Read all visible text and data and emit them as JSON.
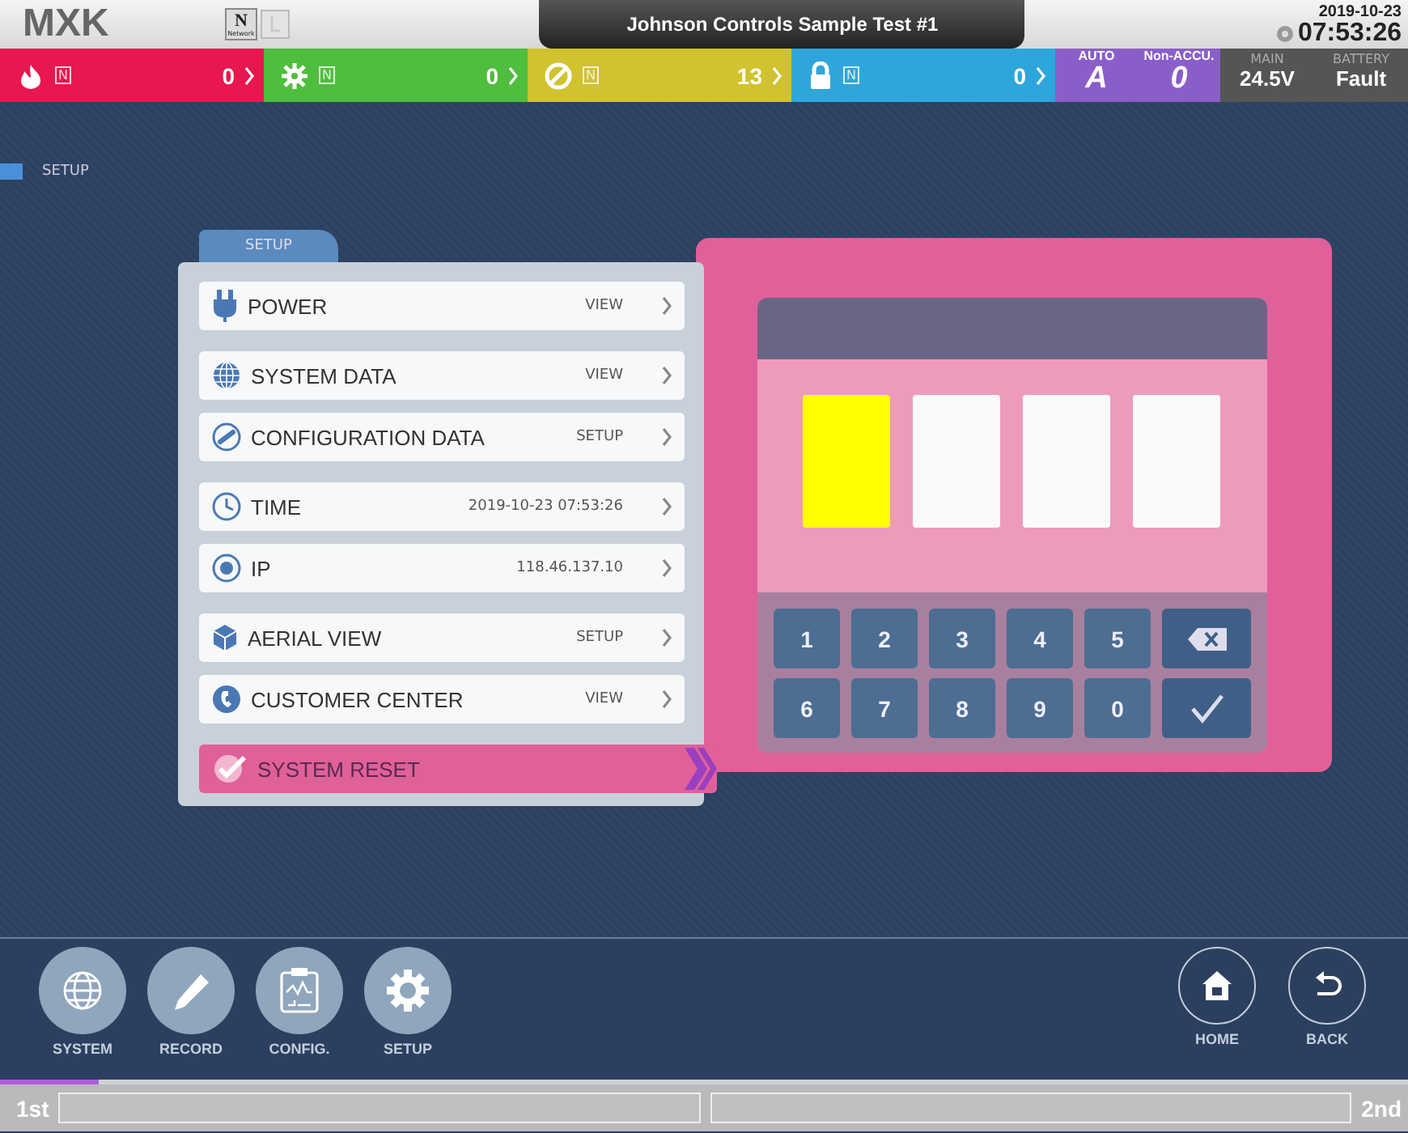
{
  "header": {
    "logo": "MXK",
    "network_badge": {
      "letter": "N",
      "label": "Network"
    },
    "title": "Johnson Controls Sample Test #1",
    "date": "2019-10-23",
    "time": "07:53:26"
  },
  "status_bar": {
    "segments": [
      {
        "kind": "fire",
        "color": "#e8174f",
        "tag": "N",
        "count": "0"
      },
      {
        "kind": "supervisory",
        "color": "#4fbd3d",
        "tag": "N",
        "count": "0"
      },
      {
        "kind": "disabled",
        "color": "#d1c230",
        "tag": "N",
        "count": "13"
      },
      {
        "kind": "security",
        "color": "#2fa6db",
        "tag": "N",
        "count": "0"
      }
    ],
    "auto": {
      "label": "AUTO",
      "value": "A"
    },
    "non_accu": {
      "label": "Non-ACCU.",
      "value": "0"
    },
    "main": {
      "label": "MAIN",
      "value": "24.5V"
    },
    "battery": {
      "label": "BATTERY",
      "value": "Fault"
    }
  },
  "breadcrumb": "SETUP",
  "setup": {
    "tab": "SETUP",
    "groups": [
      [
        {
          "label": "POWER",
          "value": "VIEW",
          "selected": false
        }
      ],
      [
        {
          "label": "SYSTEM DATA",
          "value": "VIEW",
          "selected": false
        },
        {
          "label": "CONFIGURATION DATA",
          "value": "SETUP",
          "selected": false
        }
      ],
      [
        {
          "label": "TIME",
          "value": "2019-10-23 07:53:26",
          "selected": false
        },
        {
          "label": "IP",
          "value": "118.46.137.10",
          "selected": false
        }
      ],
      [
        {
          "label": "AERIAL VIEW",
          "value": "SETUP",
          "selected": false
        },
        {
          "label": "CUSTOMER CENTER",
          "value": "VIEW",
          "selected": false
        }
      ],
      [
        {
          "label": "SYSTEM RESET",
          "selected": true
        }
      ]
    ]
  },
  "pin_dialog": {
    "slots": [
      {
        "selected": true
      },
      {
        "selected": false
      },
      {
        "selected": false
      },
      {
        "selected": false
      }
    ],
    "keys": [
      {
        "kind": "digit",
        "label": "1"
      },
      {
        "kind": "digit",
        "label": "2"
      },
      {
        "kind": "digit",
        "label": "3"
      },
      {
        "kind": "digit",
        "label": "4"
      },
      {
        "kind": "digit",
        "label": "5"
      },
      {
        "kind": "backspace"
      },
      {
        "kind": "digit",
        "label": "6"
      },
      {
        "kind": "digit",
        "label": "7"
      },
      {
        "kind": "digit",
        "label": "8"
      },
      {
        "kind": "digit",
        "label": "9"
      },
      {
        "kind": "digit",
        "label": "0"
      },
      {
        "kind": "confirm"
      }
    ]
  },
  "toolbar": {
    "left": [
      {
        "label": "SYSTEM"
      },
      {
        "label": "RECORD"
      },
      {
        "label": "CONFIG."
      },
      {
        "label": "SETUP"
      }
    ],
    "right": [
      {
        "label": "HOME"
      },
      {
        "label": "BACK"
      }
    ]
  },
  "footer": {
    "first": "1st",
    "second": "2nd",
    "level": 0.07
  }
}
